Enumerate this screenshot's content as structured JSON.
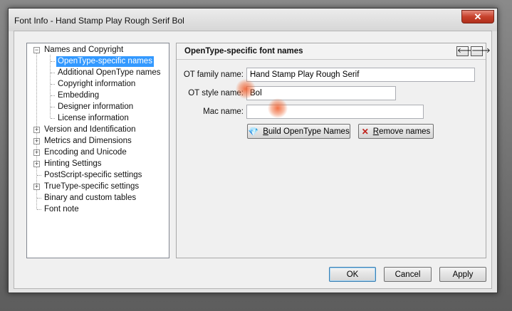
{
  "window": {
    "title": "Font Info - Hand Stamp Play Rough Serif Bol",
    "close_glyph": "✕"
  },
  "tree": {
    "items": [
      {
        "label": "Names and Copyright",
        "expander": "−"
      },
      {
        "label": "OpenType-specific names"
      },
      {
        "label": "Additional OpenType names"
      },
      {
        "label": "Copyright information"
      },
      {
        "label": "Embedding"
      },
      {
        "label": "Designer information"
      },
      {
        "label": "License information"
      },
      {
        "label": "Version and Identification",
        "expander": "+"
      },
      {
        "label": "Metrics and Dimensions",
        "expander": "+"
      },
      {
        "label": "Encoding and Unicode",
        "expander": "+"
      },
      {
        "label": "Hinting Settings",
        "expander": "+"
      },
      {
        "label": "PostScript-specific settings"
      },
      {
        "label": "TrueType-specific settings",
        "expander": "+"
      },
      {
        "label": "Binary and custom tables"
      },
      {
        "label": "Font note"
      }
    ],
    "selected": "OpenType-specific names"
  },
  "panel": {
    "title": "OpenType-specific font names",
    "prev_glyph": "🡐",
    "next_glyph": "🡒",
    "fields": {
      "family_label": "OT family name:",
      "family_value": "Hand Stamp Play Rough Serif",
      "style_label": "OT style name:",
      "style_value": "Bol",
      "mac_label": "Mac name:",
      "mac_value": ""
    },
    "build_button": {
      "mnemonic": "B",
      "rest": "uild OpenType Names",
      "icon": "💎"
    },
    "remove_button": {
      "mnemonic": "R",
      "rest": "emove names",
      "icon": "✕"
    }
  },
  "footer": {
    "ok": "OK",
    "cancel": "Cancel",
    "apply": "Apply"
  },
  "colors": {
    "selection": "#3399ff",
    "close": "#c7412c",
    "remove_icon": "#c0201a"
  }
}
